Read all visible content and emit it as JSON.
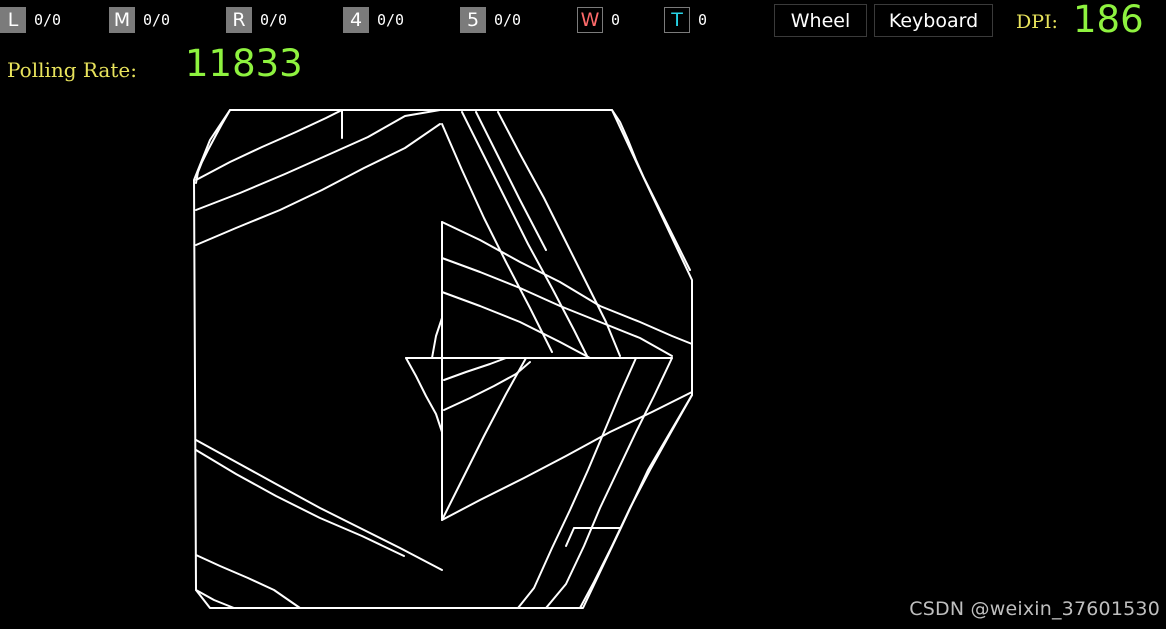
{
  "buttons": [
    {
      "key": "L",
      "count": "0/0"
    },
    {
      "key": "M",
      "count": "0/0"
    },
    {
      "key": "R",
      "count": "0/0"
    },
    {
      "key": "4",
      "count": "0/0"
    },
    {
      "key": "5",
      "count": "0/0"
    },
    {
      "key": "W",
      "count": "0"
    },
    {
      "key": "T",
      "count": "0"
    }
  ],
  "modes": {
    "wheel": "Wheel",
    "keyboard": "Keyboard"
  },
  "dpi": {
    "label": "DPI:",
    "value": "186"
  },
  "polling": {
    "label": "Polling Rate:",
    "value": "11833"
  },
  "colors": {
    "background": "#000000",
    "trace": "#ffffff",
    "value_green": "#8ef23f",
    "label_yellow": "#e8e35c",
    "wheel_red": "#ff6b6b",
    "trace_cyan": "#27d3e6"
  },
  "watermark": "CSDN @weixin_37601530"
}
